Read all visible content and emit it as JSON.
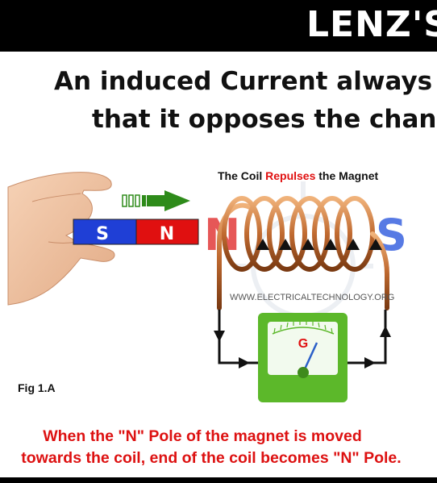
{
  "banner": {
    "title": "LENZ'S"
  },
  "headline": {
    "line1": "An induced Current always",
    "line2": "that it opposes the chang"
  },
  "diagram": {
    "title_prefix": "The Coil ",
    "title_highlight": "Repulses",
    "title_suffix": " the Magnet",
    "magnet_south_label": "S",
    "magnet_north_label": "N",
    "coil_left_pole": "N",
    "coil_right_pole": "S",
    "watermark": "WWW.ELECTRICALTECHNOLOGY.ORG",
    "galvanometer_label": "G",
    "figure_label": "Fig 1.A"
  },
  "caption": {
    "line1": "When the \"N\" Pole of the magnet is moved",
    "line2": "towards the coil, end of the coil becomes \"N\" Pole."
  },
  "colors": {
    "banner_bg": "#000000",
    "magnet_south": "#1f3fd6",
    "magnet_north": "#e01010",
    "coil_copper": "#c06a30",
    "pole_north": "#e23a3a",
    "pole_south": "#3a63e0",
    "motion_arrow": "#2e8b1a",
    "galvanometer": "#5cb82a",
    "caption_red": "#dd1111",
    "highlight_red": "#e01010"
  },
  "icons": [
    "hand-icon",
    "motion-arrow-icon",
    "galvanometer-icon",
    "current-arrow-icon",
    "watermark-bulb-icon"
  ]
}
